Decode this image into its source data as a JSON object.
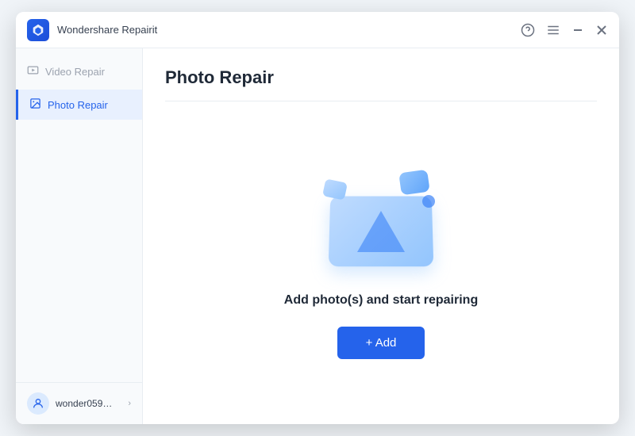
{
  "app": {
    "title": "Wondershare Repairit",
    "logo_alt": "Repairit Logo"
  },
  "titlebar": {
    "help_icon": "?",
    "menu_icon": "≡",
    "minimize_icon": "−",
    "close_icon": "×"
  },
  "sidebar": {
    "items": [
      {
        "id": "video-repair",
        "label": "Video Repair",
        "active": false
      },
      {
        "id": "photo-repair",
        "label": "Photo Repair",
        "active": true
      }
    ],
    "user": {
      "name": "wonder059@16...",
      "chevron": "›"
    }
  },
  "main": {
    "title": "Photo Repair",
    "prompt": "Add photo(s) and start repairing",
    "add_button_label": "+ Add"
  }
}
